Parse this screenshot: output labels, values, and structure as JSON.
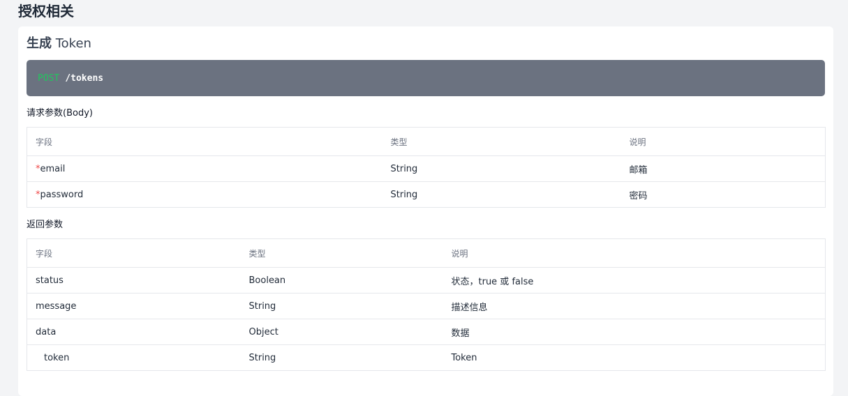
{
  "page_title": "授权相关",
  "section": {
    "title_cn": "生成",
    "title_en": "Token"
  },
  "endpoint": {
    "method": "POST",
    "path": "/tokens",
    "method_color": "#22c55e"
  },
  "request": {
    "title": "请求参数(Body)",
    "headers": [
      "字段",
      "类型",
      "说明"
    ],
    "required_mark": "*",
    "rows": [
      {
        "field": "email",
        "type": "String",
        "desc": "邮箱",
        "required": true
      },
      {
        "field": "password",
        "type": "String",
        "desc": "密码",
        "required": true
      }
    ]
  },
  "response": {
    "title": "返回参数",
    "headers": [
      "字段",
      "类型",
      "说明"
    ],
    "rows": [
      {
        "field": "status",
        "type": "Boolean",
        "desc": "状态，true 或 false"
      },
      {
        "field": "message",
        "type": "String",
        "desc": "描述信息"
      },
      {
        "field": "data",
        "type": "Object",
        "desc": "数据"
      },
      {
        "field": "token",
        "type": "String",
        "desc": "Token",
        "nested": true
      }
    ]
  }
}
